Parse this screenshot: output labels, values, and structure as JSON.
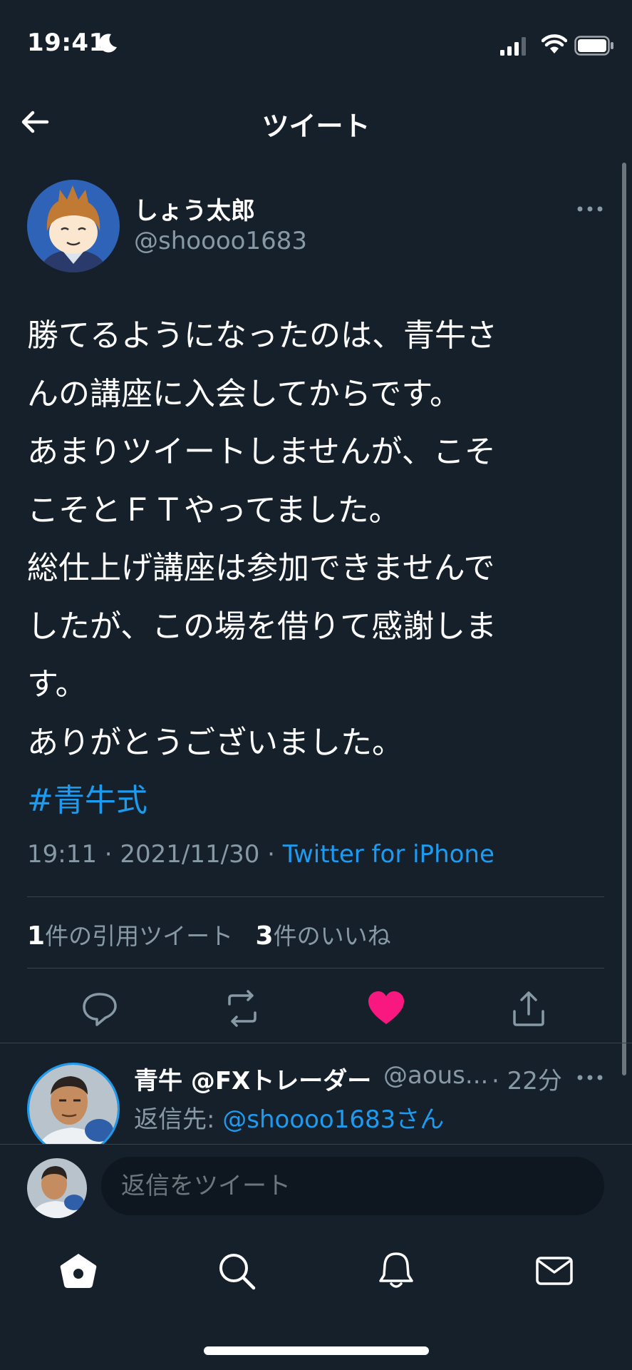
{
  "status_bar": {
    "time": "19:41"
  },
  "header": {
    "title": "ツイート"
  },
  "tweet": {
    "author_name": "しょう太郎",
    "author_handle": "@shoooo1683",
    "body_lines": [
      "勝てるようになったのは、青牛さ",
      "んの講座に入会してからです。",
      "あまりツイートしませんが、こそ",
      "こそとＦＴやってました。",
      "総仕上げ講座は参加できませんで",
      "したが、この場を借りて感謝しま",
      "す。",
      "ありがとうございました。"
    ],
    "hashtag": "#青牛式",
    "timestamp": "19:11 · 2021/11/30 · ",
    "source": "Twitter for iPhone",
    "quote_count": "1",
    "quote_label": "件の引用ツイート",
    "like_count": "3",
    "like_label": "件のいいね",
    "liked": true,
    "colors": {
      "accent": "#1d9bf0",
      "like": "#f91880",
      "background": "#15202b"
    }
  },
  "reply": {
    "author_name": "青牛 @FXトレーダー",
    "author_handle": "@aous...",
    "time": "· 22分",
    "reply_to_prefix": "返信先: ",
    "reply_to_mention": "@shoooo1683さん"
  },
  "compose": {
    "placeholder": "返信をツイート"
  },
  "tab_bar": {
    "icons": [
      "home-icon",
      "search-icon",
      "notifications-icon",
      "messages-icon"
    ]
  }
}
